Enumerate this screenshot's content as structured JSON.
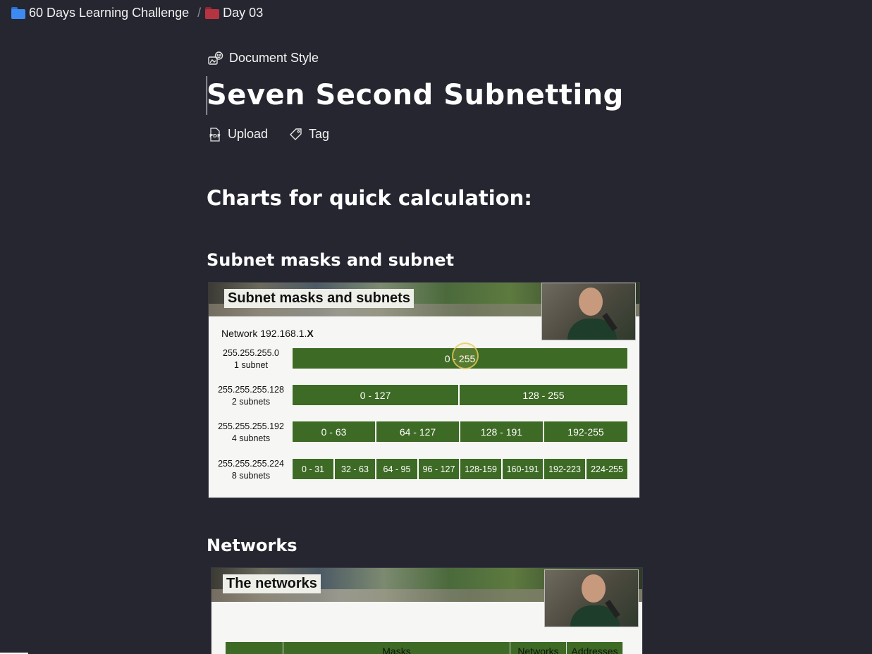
{
  "breadcrumb": {
    "root": "60 Days Learning Challenge",
    "separator": "/",
    "current": "Day 03"
  },
  "page": {
    "style_label": "Document Style",
    "title": "Seven Second Subnetting",
    "upload_label": "Upload",
    "tag_label": "Tag",
    "heading_charts": "Charts for quick calculation:",
    "heading_subnet": "Subnet masks and subnet",
    "heading_networks": "Networks"
  },
  "slide1": {
    "title": "Subnet masks and subnets",
    "network_prefix": "Network 192.168.1.",
    "network_suffix": "X",
    "rows": [
      {
        "mask": "255.255.255.0",
        "count": "1 subnet",
        "ranges": [
          "0 - 255"
        ]
      },
      {
        "mask": "255.255.255.128",
        "count": "2 subnets",
        "ranges": [
          "0 - 127",
          "128 - 255"
        ]
      },
      {
        "mask": "255.255.255.192",
        "count": "4 subnets",
        "ranges": [
          "0 - 63",
          "64 - 127",
          "128 - 191",
          "192-255"
        ]
      },
      {
        "mask": "255.255.255.224",
        "count": "8 subnets",
        "ranges": [
          "0 - 31",
          "32 - 63",
          "64 - 95",
          "96 - 127",
          "128-159",
          "160-191",
          "192-223",
          "224-255"
        ]
      }
    ]
  },
  "slide2": {
    "title": "The networks",
    "table_headers": [
      "",
      "Masks",
      "Networks",
      "Addresses"
    ]
  },
  "colors": {
    "background": "#262631",
    "cell_green": "#3d6a24",
    "folder_blue": "#3d8af0",
    "folder_red": "#b53441"
  },
  "icons": {
    "root_folder": "folder-blue-icon",
    "current_folder": "folder-red-icon",
    "style": "document-style-icon",
    "upload": "pdf-upload-icon",
    "tag": "tag-icon"
  }
}
